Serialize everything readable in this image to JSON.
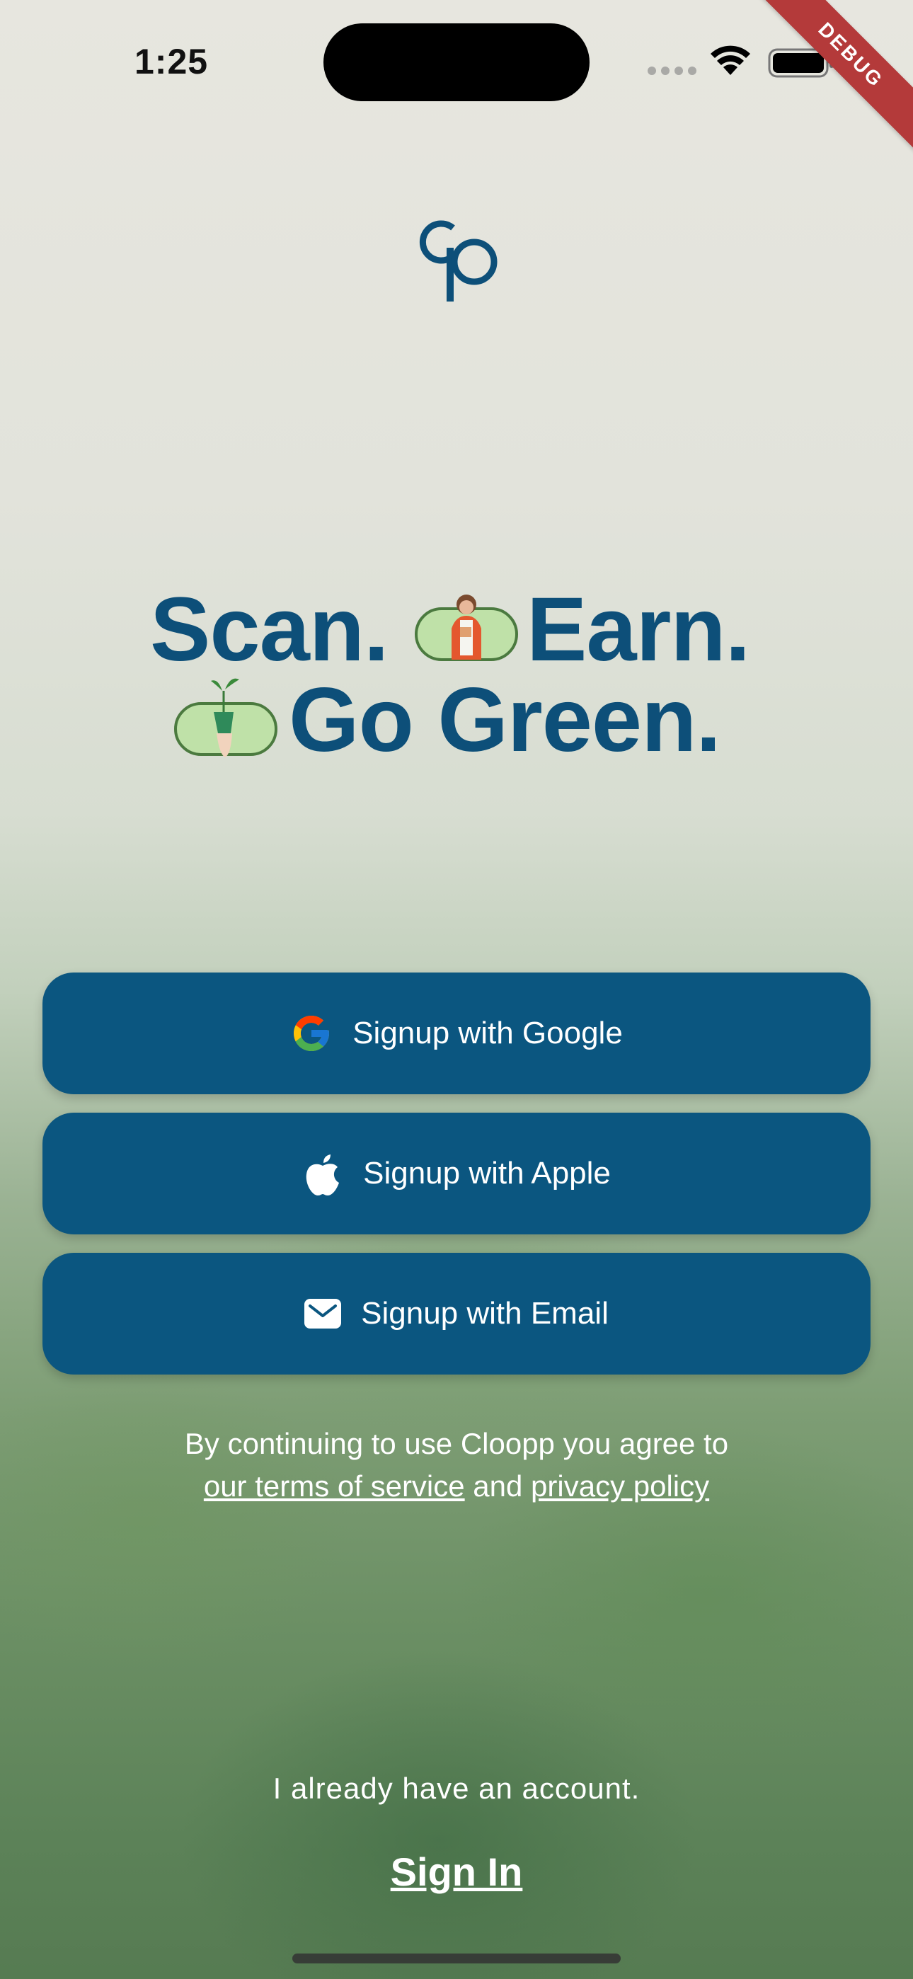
{
  "status_bar": {
    "time": "1:25",
    "debug_label": "DEBUG"
  },
  "brand": {
    "logo_alt": "Cp logo",
    "primary_color": "#0d4f79"
  },
  "headline": {
    "line1_word1": "Scan.",
    "line1_word2": "Earn.",
    "line2_word1": "Go Green."
  },
  "buttons": {
    "google": "Signup with Google",
    "apple": "Signup with Apple",
    "email": "Signup with Email",
    "color": "#0b5680"
  },
  "terms": {
    "prefix": "By continuing to use Cloopp you agree to",
    "tos_link": "our terms of service",
    "and": "and",
    "privacy_link": "privacy policy"
  },
  "account": {
    "already": "I already have an account.",
    "sign_in": "Sign In"
  }
}
